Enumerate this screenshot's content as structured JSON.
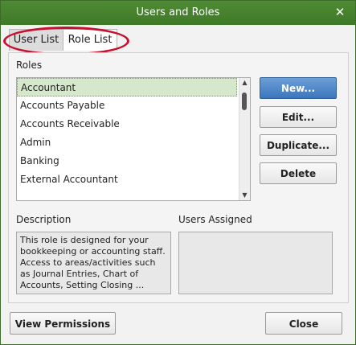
{
  "window": {
    "title": "Users and Roles"
  },
  "tabs": [
    {
      "label": "User List"
    },
    {
      "label": "Role List"
    }
  ],
  "roles": {
    "label": "Roles",
    "items": [
      "Accountant",
      "Accounts Payable",
      "Accounts Receivable",
      "Admin",
      "Banking",
      "External Accountant"
    ],
    "selected": "Accountant"
  },
  "buttons": {
    "new": "New...",
    "edit": "Edit...",
    "duplicate": "Duplicate...",
    "delete": "Delete"
  },
  "description": {
    "label": "Description",
    "text": "This role is designed for your bookkeeping or accounting staff. Access to areas/activities such as Journal Entries, Chart of Accounts, Setting Closing ..."
  },
  "users_assigned": {
    "label": "Users Assigned"
  },
  "footer": {
    "view_permissions": "View Permissions",
    "close": "Close"
  },
  "colors": {
    "titlebar": "#4f8a34",
    "selection": "#d5e8cc",
    "primary_button": "#3c76bd",
    "annotation": "#c8102e"
  }
}
